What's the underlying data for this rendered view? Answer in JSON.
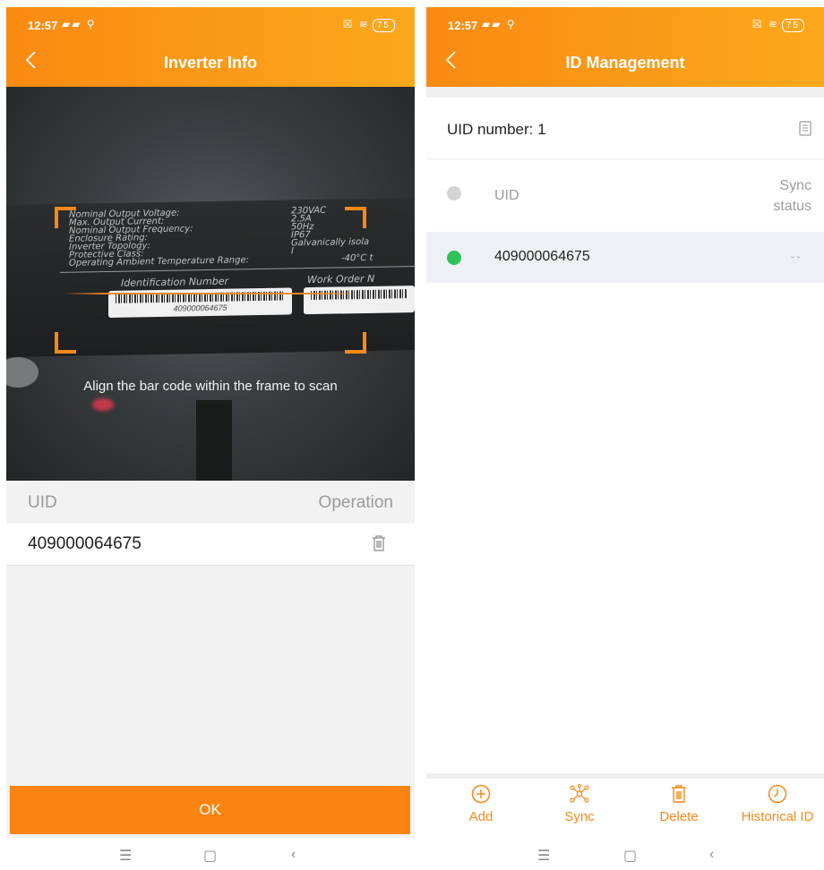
{
  "left": {
    "status": {
      "time": "12:57",
      "battery": "75"
    },
    "title": "Inverter Info",
    "camera": {
      "hint": "Align the bar code within the frame to scan",
      "plate_lines": [
        "Nominal Output Voltage:",
        "Max. Output Current:",
        "Nominal Output Frequency:",
        "Enclosure Rating:",
        "Inverter Topology:",
        "Protective Class:",
        "Operating Ambient Temperature Range:"
      ],
      "plate_values": [
        "230VAC",
        "2.5A",
        "50Hz",
        "IP67",
        "Galvanically isola",
        "I",
        "-40°C t"
      ],
      "label_identification": "Identification Number",
      "label_work_order": "Work Order N",
      "barcode_number": "409000064675"
    },
    "table": {
      "col_uid": "UID",
      "col_operation": "Operation",
      "rows": [
        {
          "uid": "409000064675"
        }
      ]
    },
    "ok_label": "OK"
  },
  "right": {
    "status": {
      "time": "12:57",
      "battery": "75"
    },
    "title": "ID Management",
    "uid_number_label": "UID number: 1",
    "list": {
      "col_uid": "UID",
      "col_sync": "Sync status",
      "rows": [
        {
          "uid": "409000064675",
          "sync": "--",
          "status_color": "#2fc25b"
        }
      ]
    },
    "tabs": [
      {
        "label": "Add",
        "icon": "add-circle-icon"
      },
      {
        "label": "Sync",
        "icon": "sync-network-icon"
      },
      {
        "label": "Delete",
        "icon": "trash-icon"
      },
      {
        "label": "Historical ID",
        "icon": "clock-icon"
      }
    ]
  },
  "colors": {
    "accent": "#fb8410",
    "header_start": "#f98a12",
    "header_end": "#fca81c",
    "online": "#2fc25b"
  }
}
